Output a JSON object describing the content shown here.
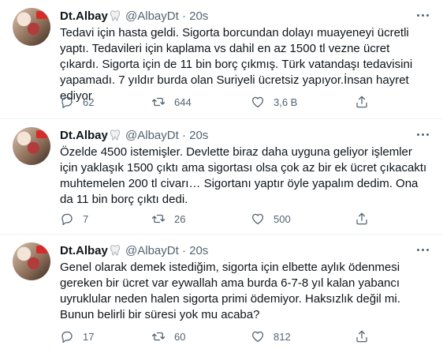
{
  "tweets": [
    {
      "name": "Dt.Albay",
      "handle": "@AlbayDt",
      "separator": "·",
      "time": "20s",
      "text": "Tedavi için hasta geldi. Sigorta borcundan dolayı muayeneyi ücretli yaptı. Tedavileri için kaplama vs dahil en az 1500 tl vezne ücret çıkardı. Sigorta için de 11 bin borç çıkmış. Türk vatandaşı tedavisini yapamadı. 7 yıldır burda olan Suriyeli ücretsiz yapıyor.İnsan hayret ediyor",
      "replies": "62",
      "retweets": "644",
      "likes": "3,6 B"
    },
    {
      "name": "Dt.Albay",
      "handle": "@AlbayDt",
      "separator": "·",
      "time": "20s",
      "text": "Özelde 4500 istemişler. Devlette biraz daha uyguna geliyor işlemler için yaklaşık 1500 çıktı ama sigortası olsa çok az bir ek ücret çıkacaktı muhtemelen 200 tl civarı… Sigortanı yaptır öyle yapalım dedim. Ona da 11 bin borç çıktı dedi.",
      "replies": "7",
      "retweets": "26",
      "likes": "500"
    },
    {
      "name": "Dt.Albay",
      "handle": "@AlbayDt",
      "separator": "·",
      "time": "20s",
      "text": "Genel olarak demek istediğim, sigorta için elbette aylık ödenmesi gereken bir ücret var eywallah ama burda 6-7-8 yıl kalan yabancı uyruklular neden halen sigorta primi ödemiyor. Haksızlık değil mi. Bunun belirli bir süresi yok mu acaba?",
      "replies": "17",
      "retweets": "60",
      "likes": "812"
    }
  ],
  "icons": {
    "verified_emoji": "tooth-icon",
    "more": "more-dots-icon",
    "reply": "reply-icon",
    "retweet": "retweet-icon",
    "like": "heart-icon",
    "share": "share-icon"
  },
  "colors": {
    "text": "#0f1419",
    "secondary": "#536471",
    "divider": "#eff3f4"
  }
}
